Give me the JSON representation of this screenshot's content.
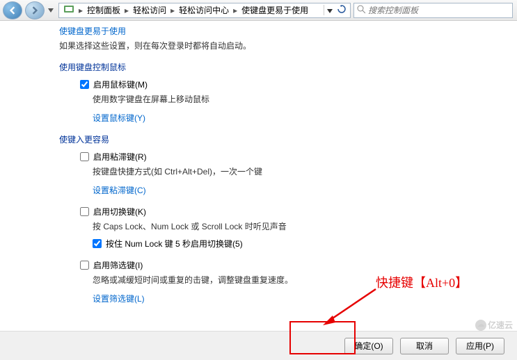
{
  "nav": {
    "breadcrumb": [
      "控制面板",
      "轻松访问",
      "轻松访问中心",
      "使键盘更易于使用"
    ],
    "search_placeholder": "搜索控制面板"
  },
  "page": {
    "top_link": "使键盘更易于使用",
    "top_desc": "如果选择这些设置，则在每次登录时都将自动启动。",
    "section1": {
      "title": "使用键盘控制鼠标",
      "option_label": "启用鼠标键(M)",
      "option_checked": true,
      "sub_desc": "使用数字键盘在屏幕上移动鼠标",
      "link": "设置鼠标键(Y)"
    },
    "section2": {
      "title": "使键入更容易",
      "opt_sticky": {
        "label": "启用粘滞键(R)",
        "checked": false,
        "desc": "按键盘快捷方式(如 Ctrl+Alt+Del)，一次一个键",
        "link": "设置粘滞键(C)"
      },
      "opt_toggle": {
        "label": "启用切换键(K)",
        "checked": false,
        "desc": "按 Caps Lock、Num Lock 或 Scroll Lock 时听见声音",
        "sub_label": "按住 Num Lock 键 5 秒启用切换键(5)",
        "sub_checked": true
      },
      "opt_filter": {
        "label": "启用筛选键(I)",
        "checked": false,
        "desc": "忽略或减缓短时间或重复的击键，调整键盘重复速度。",
        "link": "设置筛选键(L)"
      }
    }
  },
  "buttons": {
    "ok": "确定(O)",
    "cancel": "取消",
    "apply": "应用(P)"
  },
  "annotation": {
    "text": "快捷键【Alt+0】"
  },
  "watermark": "亿速云"
}
